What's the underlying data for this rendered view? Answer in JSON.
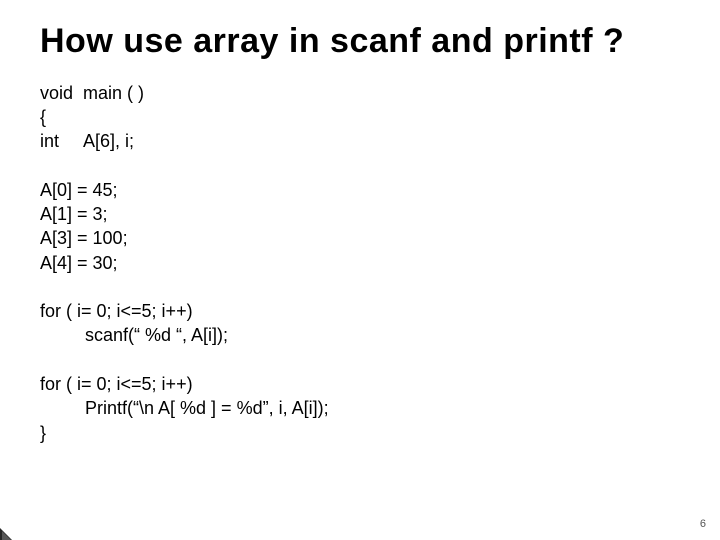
{
  "title": "How use array in scanf and printf ?",
  "code": {
    "l1": "void  main ( )",
    "l2": "{",
    "l3": "int     A[6], i;",
    "l4": "",
    "l5": "A[0] = 45;",
    "l6": "A[1] = 3;",
    "l7": "A[3] = 100;",
    "l8": "A[4] = 30;",
    "l9": "",
    "l10": "for ( i= 0; i<=5; i++)",
    "l11": "         scanf(“ %d “, A[i]);",
    "l12": "",
    "l13": "for ( i= 0; i<=5; i++)",
    "l14": "         Printf(“\\n A[ %d ] = %d”, i, A[i]);",
    "l15": "}"
  },
  "page_number": "6"
}
